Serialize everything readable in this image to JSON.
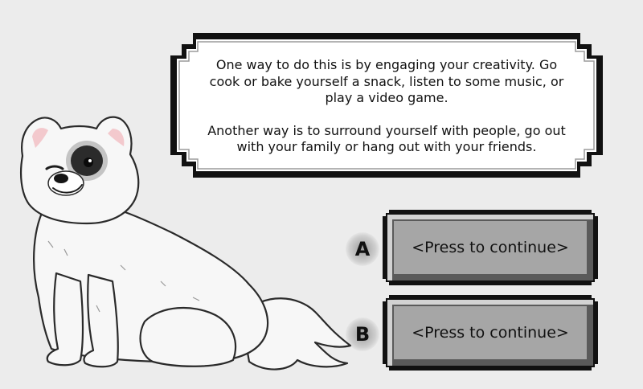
{
  "dialog": {
    "paragraph_1": "One way to do this is by engaging your creativity. Go cook or bake yourself a snack, listen to some music, or play a video game.",
    "paragraph_2": "Another way is to surround yourself with people, go out with your family or hang out with your friends."
  },
  "choices": [
    {
      "letter": "A",
      "label": "<Press to continue>"
    },
    {
      "letter": "B",
      "label": "<Press to continue>"
    }
  ],
  "colors": {
    "background": "#ececec",
    "frame": "#111111",
    "dialog_fill": "#ffffff",
    "button_fill": "#a6a6a6",
    "button_bevel_light": "#d2d2d2",
    "button_bevel_dark": "#5a5a5a"
  },
  "character": {
    "name": "white-dog-with-eye-patch"
  }
}
